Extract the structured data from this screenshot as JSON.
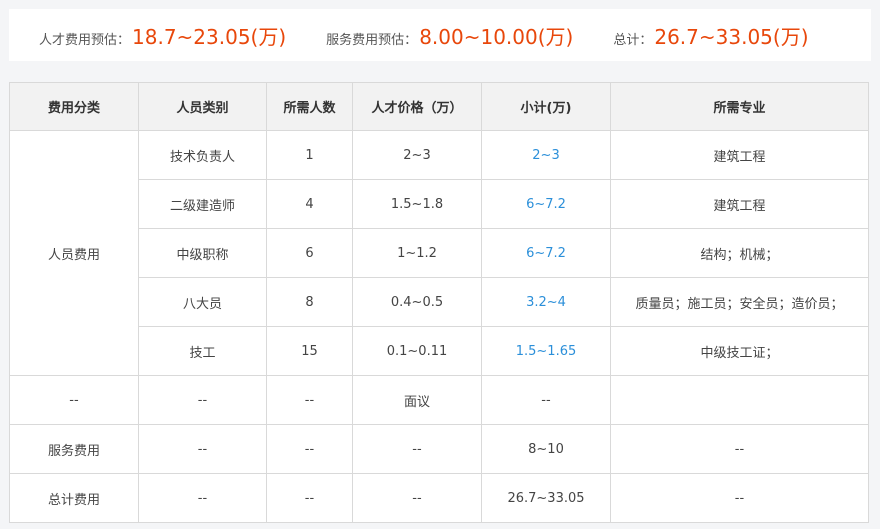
{
  "summary": {
    "talent_label": "人才费用预估：",
    "talent_value": "18.7~23.05(万)",
    "service_label": "服务费用预估：",
    "service_value": "8.00~10.00(万)",
    "total_label": "总计：",
    "total_value": "26.7~33.05(万)"
  },
  "table": {
    "headers": [
      "费用分类",
      "人员类别",
      "所需人数",
      "人才价格（万）",
      "小计(万)",
      "所需专业"
    ],
    "group_label": "人员费用",
    "rows": [
      {
        "type": "技术负责人",
        "count": "1",
        "price": "2~3",
        "subtotal": "2~3",
        "major": "建筑工程"
      },
      {
        "type": "二级建造师",
        "count": "4",
        "price": "1.5~1.8",
        "subtotal": "6~7.2",
        "major": "建筑工程"
      },
      {
        "type": "中级职称",
        "count": "6",
        "price": "1~1.2",
        "subtotal": "6~7.2",
        "major": "结构；机械；"
      },
      {
        "type": "八大员",
        "count": "8",
        "price": "0.4~0.5",
        "subtotal": "3.2~4",
        "major": "质量员；施工员；安全员；造价员；"
      },
      {
        "type": "技工",
        "count": "15",
        "price": "0.1~0.11",
        "subtotal": "1.5~1.65",
        "major": "中级技工证；"
      }
    ],
    "misc_row": {
      "category": "--",
      "type": "--",
      "count": "--",
      "price": "面议",
      "subtotal": "--",
      "major": ""
    },
    "service_row": {
      "category": "服务费用",
      "type": "--",
      "count": "--",
      "price": "--",
      "subtotal": "8~10",
      "major": "--"
    },
    "total_row": {
      "category": "总计费用",
      "type": "--",
      "count": "--",
      "price": "--",
      "subtotal": "26.7~33.05",
      "major": "--"
    }
  }
}
